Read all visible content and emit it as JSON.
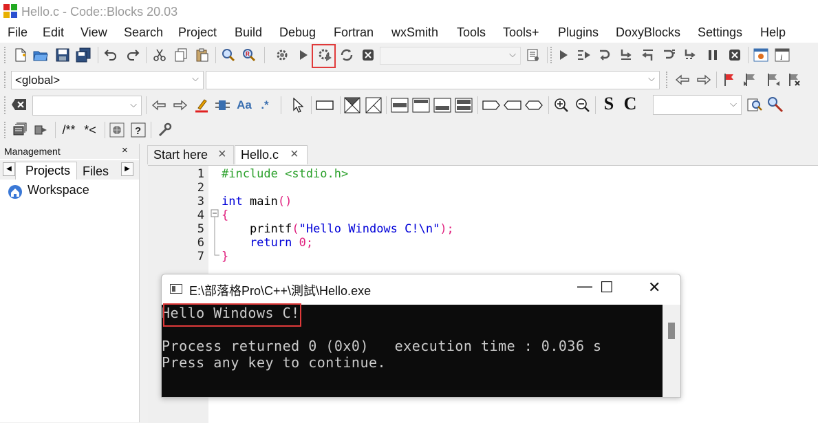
{
  "window": {
    "title": "Hello.c - Code::Blocks 20.03"
  },
  "menu": [
    "File",
    "Edit",
    "View",
    "Search",
    "Project",
    "Build",
    "Debug",
    "Fortran",
    "wxSmith",
    "Tools",
    "Tools+",
    "Plugins",
    "DoxyBlocks",
    "Settings",
    "Help"
  ],
  "toolbar": {
    "scope_combo": "<global>",
    "function_combo": "",
    "search_combo": "",
    "comment_labels": {
      "block_comment": "/**",
      "line_comment": "*<"
    },
    "text_buttons": {
      "s_label": "S",
      "c_label": "C",
      "aa_label": "Aa",
      "regex_label": ".*"
    }
  },
  "management": {
    "title": "Management",
    "close": "×",
    "tabs": [
      "Projects",
      "Files"
    ],
    "workspace": "Workspace"
  },
  "editor": {
    "tabs": [
      {
        "label": "Start here",
        "close": "×",
        "active": false
      },
      {
        "label": "Hello.c",
        "close": "×",
        "active": true
      }
    ],
    "line_numbers": [
      "1",
      "2",
      "3",
      "4",
      "5",
      "6",
      "7"
    ],
    "code": {
      "line1": "#include <stdio.h>",
      "line3_kw": "int",
      "line3_rest": " main",
      "line3_parens": "()",
      "line4": "{",
      "line5_fn": "    printf",
      "line5_open": "(",
      "line5_str": "\"Hello Windows C!\\n\"",
      "line5_close": ");",
      "line6_kw": "    return",
      "line6_num": " 0",
      "line6_semi": ";",
      "line7": "}"
    }
  },
  "console": {
    "title": "E:\\部落格Pro\\C++\\測試\\Hello.exe",
    "lines": [
      "Hello Windows C!",
      "",
      "Process returned 0 (0x0)   execution time : 0.036 s",
      "Press any key to continue."
    ],
    "buttons": {
      "minimize": "—",
      "maximize": "☐",
      "close": "✕"
    }
  },
  "colors": {
    "highlight": "#e03a3a",
    "keyword": "#0000d8",
    "preprocessor": "#2aa02a",
    "operator": "#e0207e",
    "console_bg": "#0c0c0c"
  }
}
